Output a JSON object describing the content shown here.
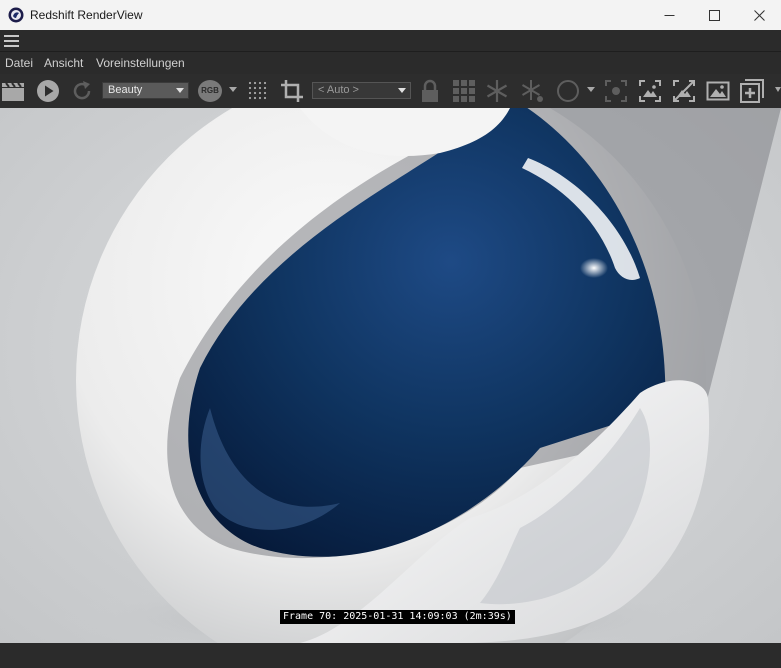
{
  "window": {
    "title": "Redshift RenderView"
  },
  "menu": {
    "items": [
      "Datei",
      "Ansicht",
      "Voreinstellungen"
    ]
  },
  "toolbar": {
    "aov_select": "Beauty",
    "channel_badge": "RGB",
    "camera_select": "< Auto >",
    "icons": [
      "clapperboard-icon",
      "play-icon",
      "refresh-icon",
      "rgb-channel-icon",
      "dither-grid-icon",
      "crop-icon",
      "lock-icon",
      "grid-icon",
      "snowflake-icon",
      "snowflake-dots-icon",
      "circle-icon",
      "focus-icon",
      "fit-frame-icon",
      "no-overlay-icon",
      "image-icon",
      "add-snapshot-icon"
    ]
  },
  "viewport": {
    "frame_info": "Frame 70: 2025-01-31 14:09:03 (2m:39s)"
  },
  "colors": {
    "titlebar_bg": "#f3f3f3",
    "ui_bg": "#2b2b2b",
    "dropdown_bg": "#5a5a5a",
    "sphere_blue": "#0f3460"
  }
}
